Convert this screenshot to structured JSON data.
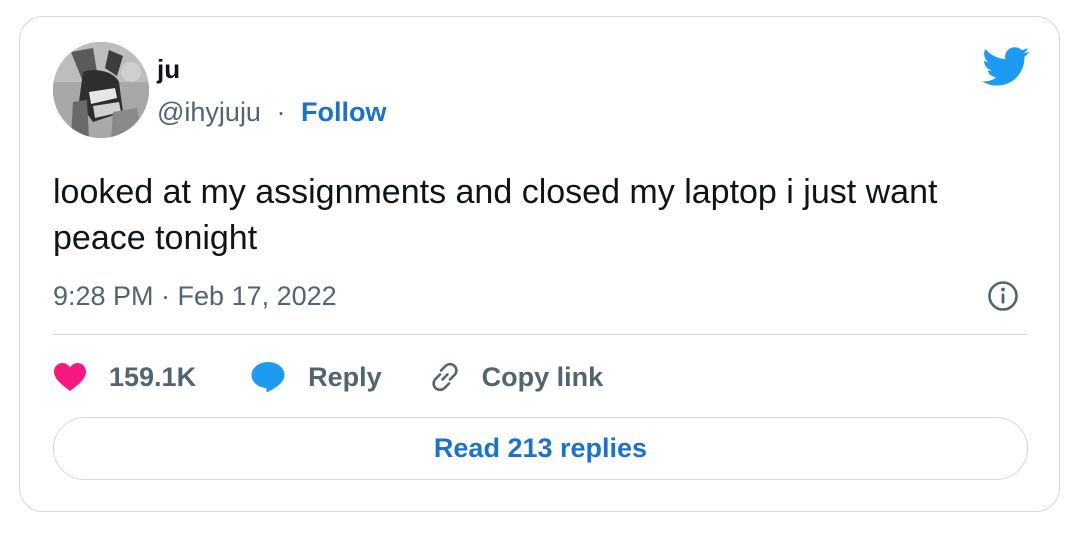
{
  "author": {
    "name": "ju",
    "handle": "@ihyjuju",
    "separator": "·",
    "follow_label": "Follow"
  },
  "tweet": {
    "text": "looked at my assignments and closed my laptop i just want peace tonight",
    "timestamp": "9:28 PM · Feb 17, 2022"
  },
  "actions": {
    "like_count": "159.1K",
    "reply_label": "Reply",
    "copy_link_label": "Copy link"
  },
  "read_replies_label": "Read 213 replies",
  "icons": {
    "brand": "twitter-bird-icon",
    "like": "heart-icon",
    "reply": "speech-bubble-icon",
    "copy": "link-icon",
    "info": "info-icon"
  },
  "colors": {
    "twitter_blue": "#1d9bf0",
    "link_blue": "#1b72c9",
    "heart": "#f91880",
    "text": "#0f1419",
    "secondary": "#536471",
    "border": "#cfd9de"
  }
}
